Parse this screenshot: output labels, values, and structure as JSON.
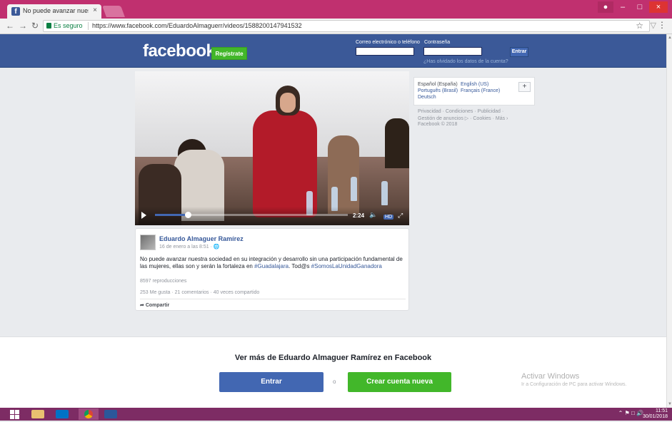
{
  "browser": {
    "tab_title": "No puede avanzar nuest",
    "tab_close": "×",
    "secure_label": "Es seguro",
    "url": "https://www.facebook.com/EduardoAlmaguerr/videos/1588200147941532",
    "icons": [
      "back-icon",
      "forward-icon",
      "reload-icon",
      "lock-icon",
      "star-icon",
      "menu-icon"
    ]
  },
  "header": {
    "logo": "facebook",
    "signup_label": "Regístrate",
    "email_label": "Correo electrónico o teléfono",
    "password_label": "Contraseña",
    "login_label": "Entrar",
    "forgot_label": "¿Has olvidado los datos de la cuenta?"
  },
  "video": {
    "time": "2:24",
    "progress": 0.17,
    "hd": "HD"
  },
  "post": {
    "author": "Eduardo Almaguer Ramírez",
    "date": "16 de enero a las 8:51 · ",
    "text_start": "No puede avanzar nuestra sociedad en su integración y desarrollo sin una participación fundamental de las mujeres, ellas son y serán la fortaleza en ",
    "hashtag1": "#Guadalajara",
    "text_mid": ". Tod@s ",
    "hashtag2": "#SomosLaUnidadGanadora",
    "views": "8597 reproducciones",
    "stats": "253 Me gusta · 21 comentarios · 40 veces compartido",
    "share_label": "Compartir"
  },
  "sidebar": {
    "languages": [
      "Español (España)",
      "English (US)",
      "Português (Brasil)",
      "Français (France)",
      "Deutsch"
    ],
    "plus": "+",
    "footer_line1": "Privacidad · Condiciones · Publicidad ·",
    "footer_line2": "Gestión de anuncios ▷ · Cookies · Más ›",
    "footer_line3": "Facebook © 2018"
  },
  "bottom": {
    "see_more": "Ver más de Eduardo Almaguer Ramírez en Facebook",
    "entrar": "Entrar",
    "or": "o",
    "crear": "Crear cuenta nueva",
    "activate_title": "Activar Windows",
    "activate_sub": "Ir a Configuración de PC para activar Windows."
  },
  "taskbar": {
    "time": "11:51",
    "date": "30/01/2018"
  },
  "colors": {
    "fb_blue": "#3b5998",
    "fb_green": "#42b72a",
    "chrome_frame": "#c0306f"
  }
}
